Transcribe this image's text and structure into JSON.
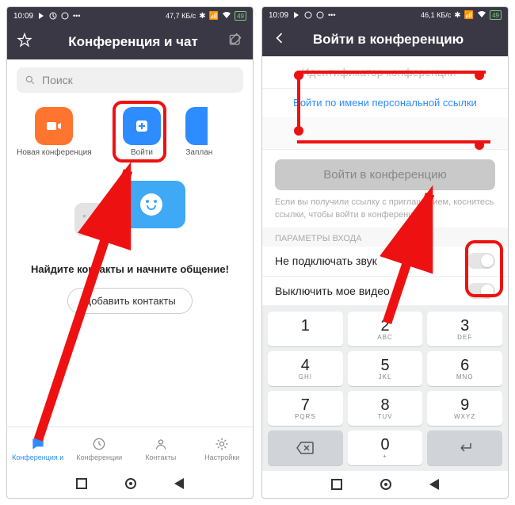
{
  "status": {
    "time": "10:09",
    "net_speed_left": "47,7 КБ/с",
    "net_speed_right": "46,1 КБ/с",
    "battery": "49"
  },
  "left": {
    "title": "Конференция и чат",
    "search_placeholder": "Поиск",
    "actions": {
      "new_meeting": "Новая конференция",
      "join": "Войти",
      "schedule": "Заплан"
    },
    "promo": "Найдите контакты и начните общение!",
    "add_contacts": "Добавить контакты",
    "tabs": {
      "meet_chat": "Конференция и",
      "meetings": "Конференции",
      "contacts": "Контакты",
      "settings": "Настройки"
    }
  },
  "right": {
    "title": "Войти в конференцию",
    "id_placeholder": "Идентификатор конференции",
    "personal_link": "Войти по имени персональной ссылки",
    "join_btn": "Войти в конференцию",
    "hint": "Если вы получили ссылку с приглашением, коснитесь ссылки, чтобы войти в конференцию",
    "section": "ПАРАМЕТРЫ ВХОДА",
    "opt_audio": "Не подключать звук",
    "opt_video": "Выключить мое видео",
    "keypad": {
      "k1": "1",
      "k2": "2",
      "k3": "3",
      "k4": "4",
      "k5": "5",
      "k6": "6",
      "k7": "7",
      "k8": "8",
      "k9": "9",
      "k0": "0",
      "s2": "ABC",
      "s3": "DEF",
      "s4": "GHI",
      "s5": "JKL",
      "s6": "MNO",
      "s7": "PQRS",
      "s8": "TUV",
      "s9": "WXYZ",
      "s0": "+"
    }
  }
}
